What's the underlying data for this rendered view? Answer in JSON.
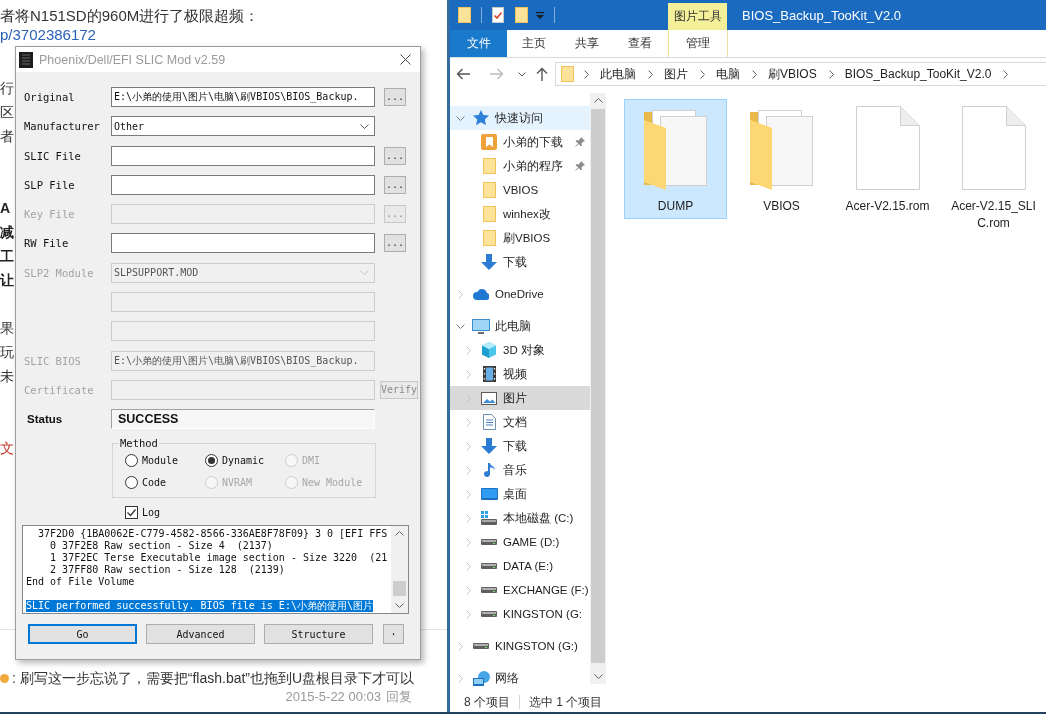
{
  "forum_page": {
    "intro": "者将N151SD的960M进行了极限超频：",
    "link": "p/3702386172",
    "paragraphs": [
      {
        "kind": "plain",
        "lines": [
          "行",
          "区",
          "者"
        ]
      },
      {
        "kind": "bold",
        "lines": [
          "A",
          "减",
          "工",
          "让"
        ]
      },
      {
        "kind": "plain",
        "lines": [
          "果",
          "玩",
          "未"
        ]
      },
      {
        "kind": "red",
        "lines": [
          "文"
        ]
      }
    ],
    "comment": {
      "text": ": 刷写这一步忘说了，需要把“flash.bat”也拖到U盘根目录下才可以",
      "date": "2015-5-22 00:03",
      "reply": "回复"
    }
  },
  "slic_dialog": {
    "title": "Phoenix/Dell/EFI SLIC Mod v2.59",
    "rows": [
      {
        "kind": "file",
        "label": "Original",
        "value": "E:\\小弟的使用\\图片\\电脑\\刷VBIOS\\BIOS_Backup.",
        "disabled": false,
        "button": "..."
      },
      {
        "kind": "dropdown",
        "label": "Manufacturer",
        "value": "Other",
        "disabled": false
      },
      {
        "kind": "file",
        "label": "SLIC File",
        "disabled": false,
        "button": "..."
      },
      {
        "kind": "file",
        "label": "SLP File",
        "disabled": false,
        "button": "..."
      },
      {
        "kind": "file",
        "label": "Key File",
        "disabled": true,
        "button": "..."
      },
      {
        "kind": "file",
        "label": "RW File",
        "disabled": false,
        "button": "..."
      },
      {
        "kind": "dropdown",
        "label": "SLP2 Module",
        "value": "SLPSUPPORT.MOD",
        "disabled": true
      },
      {
        "kind": "text",
        "disabled": true
      },
      {
        "kind": "text",
        "disabled": true
      },
      {
        "kind": "text",
        "label": "SLIC BIOS",
        "value": "E:\\小弟的使用\\图片\\电脑\\刷VBIOS\\BIOS_Backup.",
        "disabled": true
      },
      {
        "kind": "verify",
        "label": "Certificate",
        "disabled": true,
        "button": "Verify"
      },
      {
        "kind": "status",
        "label": "Status",
        "value": "SUCCESS",
        "disabled": false
      }
    ],
    "method": {
      "legend": "Method",
      "options": [
        {
          "label": "Module",
          "selected": false,
          "disabled": false
        },
        {
          "label": "Dynamic",
          "selected": true,
          "disabled": false
        },
        {
          "label": "DMI",
          "selected": false,
          "disabled": true
        },
        {
          "label": "Code",
          "selected": false,
          "disabled": false
        },
        {
          "label": "NVRAM",
          "selected": false,
          "disabled": true
        },
        {
          "label": "New Module",
          "selected": false,
          "disabled": true
        }
      ]
    },
    "log_option": {
      "label": "Log",
      "checked": true
    },
    "log_lines": [
      {
        "text": "  37F2D0 {1BA0062E-C779-4582-8566-336AE8F78F09} 3 0 [EFI FFS",
        "selected": false
      },
      {
        "text": "    0 37F2E8 Raw section - Size 4  (2137)",
        "selected": false
      },
      {
        "text": "    1 37F2EC Terse Executable image section - Size 3220  (21",
        "selected": false
      },
      {
        "text": "    2 37FF80 Raw section - Size 128  (2139)",
        "selected": false
      },
      {
        "text": "End of File Volume",
        "selected": false
      },
      {
        "text": "SLIC performed successfully. BIOS file is E:\\小弟的使用\\图片",
        "selected": true
      }
    ],
    "buttons": [
      {
        "label": "Go",
        "kind": "wide",
        "focused": true
      },
      {
        "label": "Advanced",
        "kind": "wide",
        "focused": false
      },
      {
        "label": "Structure",
        "kind": "wide",
        "focused": false
      },
      {
        "label": "·",
        "kind": "narrow",
        "focused": false
      }
    ]
  },
  "explorer": {
    "tool_tab": "图片工具",
    "title": "BIOS_Backup_TooKit_V2.0",
    "ribbon_tabs": [
      {
        "label": "文件",
        "kind": "file"
      },
      {
        "label": "主页",
        "kind": "tab"
      },
      {
        "label": "共享",
        "kind": "tab"
      },
      {
        "label": "查看",
        "kind": "tab"
      },
      {
        "label": "管理",
        "kind": "contextual"
      }
    ],
    "breadcrumb": [
      "此电脑",
      "图片",
      "电脑",
      "刷VBIOS",
      "BIOS_Backup_TooKit_V2.0"
    ],
    "nav_tree": [
      {
        "label": "快速访问",
        "kind": "star",
        "expanded": true,
        "selected": false,
        "hovered": true,
        "children": [
          {
            "label": "小弟的下载",
            "kind": "special-folder",
            "pinned": true,
            "selected": false,
            "hovered": false
          },
          {
            "label": "小弟的程序",
            "kind": "folder",
            "pinned": true,
            "selected": false,
            "hovered": false
          },
          {
            "label": "VBIOS",
            "kind": "folder",
            "pinned": false,
            "selected": false,
            "hovered": false
          },
          {
            "label": "winhex改",
            "kind": "folder",
            "pinned": false,
            "selected": false,
            "hovered": false
          },
          {
            "label": "刷VBIOS",
            "kind": "folder",
            "pinned": false,
            "selected": false,
            "hovered": false
          },
          {
            "label": "下载",
            "kind": "download",
            "pinned": false,
            "selected": false,
            "hovered": false
          }
        ]
      },
      {
        "label": "OneDrive",
        "kind": "cloud",
        "expanded": false,
        "selected": false,
        "hovered": false
      },
      {
        "label": "此电脑",
        "kind": "computer",
        "expanded": true,
        "selected": false,
        "hovered": false,
        "children": [
          {
            "label": "3D 对象",
            "kind": "cube",
            "expanded": false,
            "selected": false,
            "hovered": false
          },
          {
            "label": "视频",
            "kind": "film",
            "expanded": false,
            "selected": false,
            "hovered": false
          },
          {
            "label": "图片",
            "kind": "picture",
            "expanded": false,
            "selected": true,
            "hovered": false
          },
          {
            "label": "文档",
            "kind": "document",
            "expanded": false,
            "selected": false,
            "hovered": false
          },
          {
            "label": "下载",
            "kind": "download",
            "expanded": false,
            "selected": false,
            "hovered": false
          },
          {
            "label": "音乐",
            "kind": "music",
            "expanded": false,
            "selected": false,
            "hovered": false
          },
          {
            "label": "桌面",
            "kind": "desktop",
            "expanded": false,
            "selected": false,
            "hovered": false
          },
          {
            "label": "本地磁盘 (C:)",
            "kind": "system-drive",
            "expanded": false,
            "selected": false,
            "hovered": false
          },
          {
            "label": "GAME (D:)",
            "kind": "drive",
            "expanded": false,
            "selected": false,
            "hovered": false
          },
          {
            "label": "DATA (E:)",
            "kind": "drive",
            "expanded": false,
            "selected": false,
            "hovered": false
          },
          {
            "label": "EXCHANGE (F:)",
            "kind": "drive",
            "expanded": false,
            "selected": false,
            "hovered": false
          },
          {
            "label": "KINGSTON (G:",
            "kind": "drive",
            "expanded": false,
            "selected": false,
            "hovered": false
          }
        ]
      },
      {
        "label": "KINGSTON (G:)",
        "kind": "drive",
        "expanded": false,
        "selected": false,
        "hovered": false
      },
      {
        "label": "网络",
        "kind": "network",
        "expanded": false,
        "selected": false,
        "hovered": false
      }
    ],
    "files": [
      {
        "name": "DUMP",
        "kind": "folder",
        "selected": true
      },
      {
        "name": "VBIOS",
        "kind": "folder",
        "selected": false
      },
      {
        "name": "Acer-V2.15.rom",
        "kind": "file",
        "selected": false
      },
      {
        "name": "Acer-V2.15_SLIC.rom",
        "kind": "file",
        "selected": false
      }
    ],
    "status_bar": [
      "8 个项目",
      "选中 1 个项目"
    ]
  }
}
